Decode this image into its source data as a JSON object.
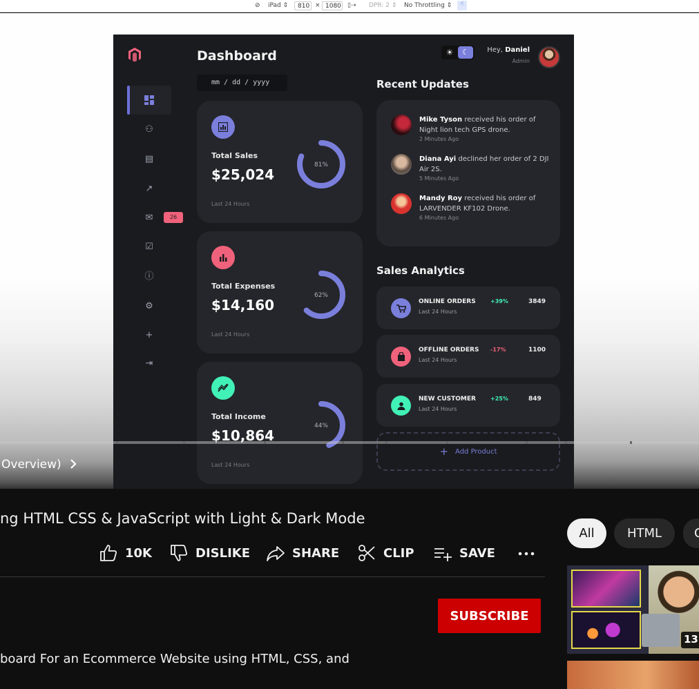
{
  "devtools": {
    "device": "iPad",
    "width": "810",
    "times": "×",
    "height": "1080",
    "dpr": "DPR: 2",
    "throttling": "No Throttling"
  },
  "dashboard": {
    "title": "Dashboard",
    "date_placeholder": "mm / dd / yyyy",
    "messages_badge": "26",
    "theme_icons": [
      "sun-icon",
      "moon-icon"
    ],
    "user": {
      "greeting": "Hey,",
      "name": "Daniel",
      "role": "Admin"
    },
    "cards": [
      {
        "label": "Total Sales",
        "value": "$25,024",
        "percent": "81%",
        "percent_value": 0.81,
        "note": "Last 24 Hours",
        "color": "#7b7fdc"
      },
      {
        "label": "Total Expenses",
        "value": "$14,160",
        "percent": "62%",
        "percent_value": 0.62,
        "note": "Last 24 Hours",
        "color": "#f0627b"
      },
      {
        "label": "Total Income",
        "value": "$10,864",
        "percent": "44%",
        "percent_value": 0.44,
        "note": "Last 24 Hours",
        "color": "#41f1b6"
      }
    ],
    "recent_updates_title": "Recent Updates",
    "updates": [
      {
        "name": "Mike Tyson",
        "text": "received his order of Night lion tech GPS drone.",
        "time": "2 Minutes Ago"
      },
      {
        "name": "Diana Ayi",
        "text": "declined her order of 2 DJI Air 2S.",
        "time": "5 Minutes Ago"
      },
      {
        "name": "Mandy Roy",
        "text": "received his order of LARVENDER KF102 Drone.",
        "time": "6 Minutes Ago"
      }
    ],
    "sales_analytics_title": "Sales Analytics",
    "analytics": [
      {
        "name": "ONLINE ORDERS",
        "sub": "Last 24 Hours",
        "change": "+39%",
        "value": "3849",
        "color": "#7b7fdc",
        "change_color": "#41f1b6"
      },
      {
        "name": "OFFLINE ORDERS",
        "sub": "Last 24 Hours",
        "change": "-17%",
        "value": "1100",
        "color": "#f0627b",
        "change_color": "#f0627b"
      },
      {
        "name": "NEW CUSTOMER",
        "sub": "Last 24 Hours",
        "change": "+25%",
        "value": "849",
        "color": "#41f1b6",
        "change_color": "#41f1b6"
      }
    ],
    "add_product": "Add Product"
  },
  "player": {
    "chapter": "Overview)"
  },
  "video": {
    "title": "ng HTML CSS & JavaScript with Light & Dark Mode",
    "likes": "10K",
    "dislike": "DISLIKE",
    "share": "SHARE",
    "clip": "CLIP",
    "save": "SAVE",
    "subscribe": "SUBSCRIBE",
    "description": "board For an Ecommerce Website using HTML, CSS, and"
  },
  "chips": [
    "All",
    "HTML",
    "C"
  ],
  "thumbnail_duration": "13"
}
